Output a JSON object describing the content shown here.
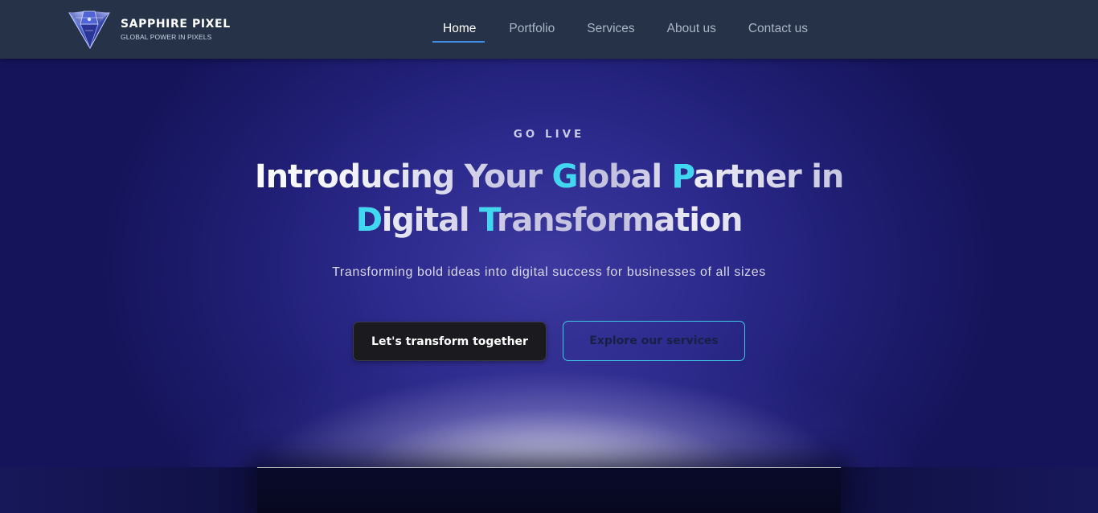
{
  "brand": {
    "name": "SAPPHIRE PIXEL",
    "tagline": "GLOBAL POWER IN PIXELS",
    "logo_icon": "sapphire-gem-icon"
  },
  "nav": {
    "items": [
      {
        "label": "Home",
        "active": true
      },
      {
        "label": "Portfolio",
        "active": false
      },
      {
        "label": "Services",
        "active": false
      },
      {
        "label": "About us",
        "active": false
      },
      {
        "label": "Contact us",
        "active": false
      }
    ],
    "active_underline_color": "#3f8ee6"
  },
  "hero": {
    "eyebrow": "GO LIVE",
    "headline_line1": {
      "p1": "Introducing Your ",
      "a1": "G",
      "p2": "lobal ",
      "a2": "P",
      "p3": "artner in"
    },
    "headline_line2": {
      "a1": "D",
      "p1": "igital ",
      "a2": "T",
      "p2": "ransformation"
    },
    "accent_color": "#3fd8f0",
    "subtitle": "Transforming bold ideas into digital success for businesses of all sizes",
    "primary_button": "Let's transform together",
    "secondary_button": "Explore our services"
  },
  "colors": {
    "navbar_bg": "#253247",
    "hero_bg": "#2c2a8c",
    "secondary_button_border": "#3fc7e6"
  }
}
